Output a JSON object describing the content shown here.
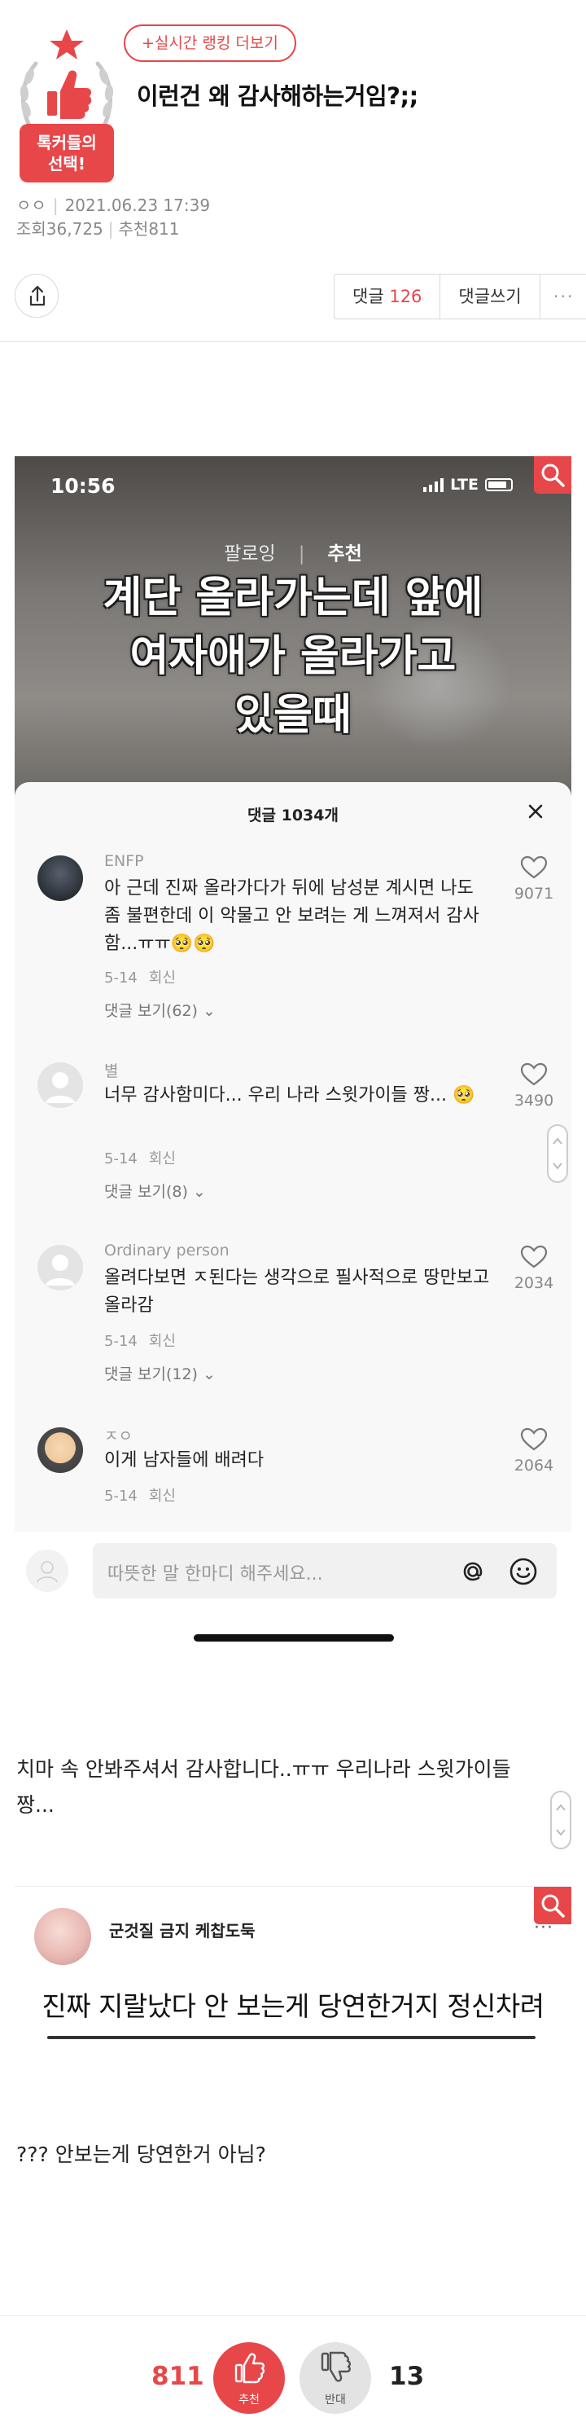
{
  "header": {
    "badge_text_line1": "톡커들의",
    "badge_text_line2": "선택!",
    "ranking_button": "+실시간 랭킹 더보기",
    "title": "이런건 왜 감사해하는거임?;;",
    "author": "ㅇㅇ",
    "date": "2021.06.23 17:39",
    "views": "조회36,725",
    "recommends": "추천811"
  },
  "actionbar": {
    "comment_label": "댓글",
    "comment_count": "126",
    "write_label": "댓글쓰기",
    "more_label": "···"
  },
  "shot1": {
    "status_time": "10:56",
    "network": "LTE",
    "tabs": [
      "팔로잉",
      "추천"
    ],
    "overlay_lines": [
      "계단 올라가는데 앞에",
      "여자애가 올라가고",
      "있을때"
    ],
    "sheet_title": "댓글 1034개",
    "comments": [
      {
        "name": "ENFP",
        "text": "아 근데 진짜 올라가다가 뒤에 남성분 계시면 나도 좀 불편한데 이 악물고 안 보려는 게 느껴져서 감사함...ㅠㅠ🥺🥺",
        "date": "5-14",
        "reply": "회신",
        "replies": "댓글 보기(62)",
        "likes": "9071"
      },
      {
        "name": "별",
        "text": "너무 감사함미다... 우리 나라 스윗가이들 짱... 🥺",
        "date": "5-14",
        "reply": "회신",
        "replies": "댓글 보기(8)",
        "likes": "3490"
      },
      {
        "name": "Ordinary person",
        "text": "올려다보면 ㅈ된다는 생각으로 필사적으로 땅만보고 올라감",
        "date": "5-14",
        "reply": "회신",
        "replies": "댓글 보기(12)",
        "likes": "2034"
      },
      {
        "name": "ㅈㅇ",
        "text": "이게 남자들에 배려다",
        "date": "5-14",
        "reply": "회신",
        "replies": "",
        "likes": "2064"
      }
    ],
    "input_placeholder": "따뜻한 말 한마디 해주세요..."
  },
  "body_text_1": "치마 속 안봐주셔서 감사합니다..ㅠㅠ 우리나라 스윗가이들 짱...",
  "shot2": {
    "username": "군것질 금지 케찹도둑",
    "more": "···",
    "text": "진짜 지랄났다 안 보는게 당연한거지 정신차려"
  },
  "body_text_2": "??? 안보는게 당연한거 아님?",
  "vote": {
    "up_count": "811",
    "up_label": "추천",
    "down_label": "반대",
    "down_count": "13"
  },
  "colors": {
    "accent": "#e8474a",
    "text": "#222222",
    "muted": "#888888"
  }
}
